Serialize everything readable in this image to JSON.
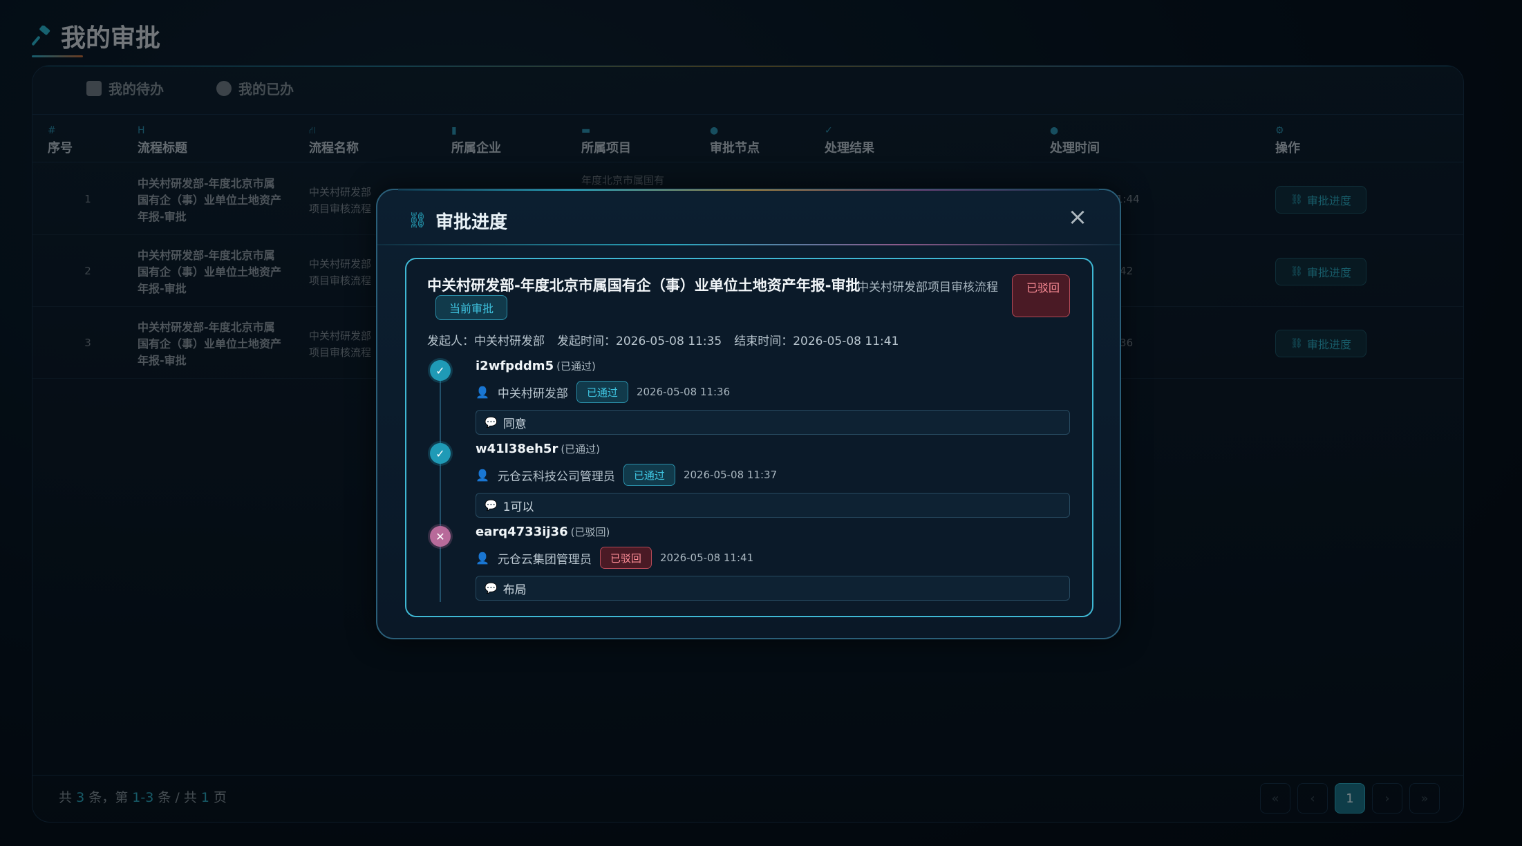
{
  "page": {
    "title": "我的审批"
  },
  "tabs": [
    {
      "label": "我的待办"
    },
    {
      "label": "我的已办"
    }
  ],
  "table": {
    "columns": [
      "序号",
      "流程标题",
      "流程名称",
      "所属企业",
      "所属项目",
      "审批节点",
      "处理结果",
      "处理时间",
      "操作"
    ],
    "rows": [
      {
        "index": "1",
        "title": "中关村研发部-年度北京市属国有企（事）业单位土地资产年报-审批",
        "flow": "中关村研发部项目审核流程",
        "project": "年度北京市属国有",
        "time": "1:44",
        "action": "审批进度"
      },
      {
        "index": "2",
        "title": "中关村研发部-年度北京市属国有企（事）业单位土地资产年报-审批",
        "flow": "中关村研发部项目审核流程",
        "time": ":42",
        "action": "审批进度"
      },
      {
        "index": "3",
        "title": "中关村研发部-年度北京市属国有企（事）业单位土地资产年报-审批",
        "flow": "中关村研发部项目审核流程",
        "time": ":36",
        "action": "审批进度"
      }
    ]
  },
  "footer": {
    "p1": "共",
    "total": "3",
    "p2": "条，第",
    "range": "1-3",
    "p3": "条 / 共",
    "pages": "1",
    "p4": "页",
    "current_page": "1"
  },
  "modal": {
    "title": "审批进度",
    "task_title": "中关村研发部-年度北京市属国有企（事）业单位土地资产年报-审批",
    "flow_name": "中关村研发部项目审核流程",
    "status_badge": "已驳回",
    "current_badge": "当前审批",
    "meta": {
      "initiator": "发起人：中关村研发部",
      "start_time": "发起时间：2026-05-08 11:35",
      "end_time": "结束时间：2026-05-08 11:41"
    },
    "steps": [
      {
        "name": "i2wfpddm5",
        "status_text": "(已通过)",
        "user": "中关村研发部",
        "chip": "已通过",
        "time": "2026-05-08 11:36",
        "comment": "同意",
        "result": "ok"
      },
      {
        "name": "w41l38eh5r",
        "status_text": "(已通过)",
        "user": "元仓云科技公司管理员",
        "chip": "已通过",
        "time": "2026-05-08 11:37",
        "comment": "1可以",
        "result": "ok"
      },
      {
        "name": "earq4733ij36",
        "status_text": "(已驳回)",
        "user": "元仓云集团管理员",
        "chip": "已驳回",
        "time": "2026-05-08 11:41",
        "comment": "布局",
        "result": "no"
      }
    ]
  },
  "colors": {
    "accent": "#2aa6be",
    "danger": "#ff8e98",
    "background": "#06101a"
  },
  "icons": [
    "hammer-icon",
    "inbox-icon",
    "check-circle-icon",
    "close-icon",
    "user-icon",
    "comment-icon",
    "flow-icon"
  ]
}
